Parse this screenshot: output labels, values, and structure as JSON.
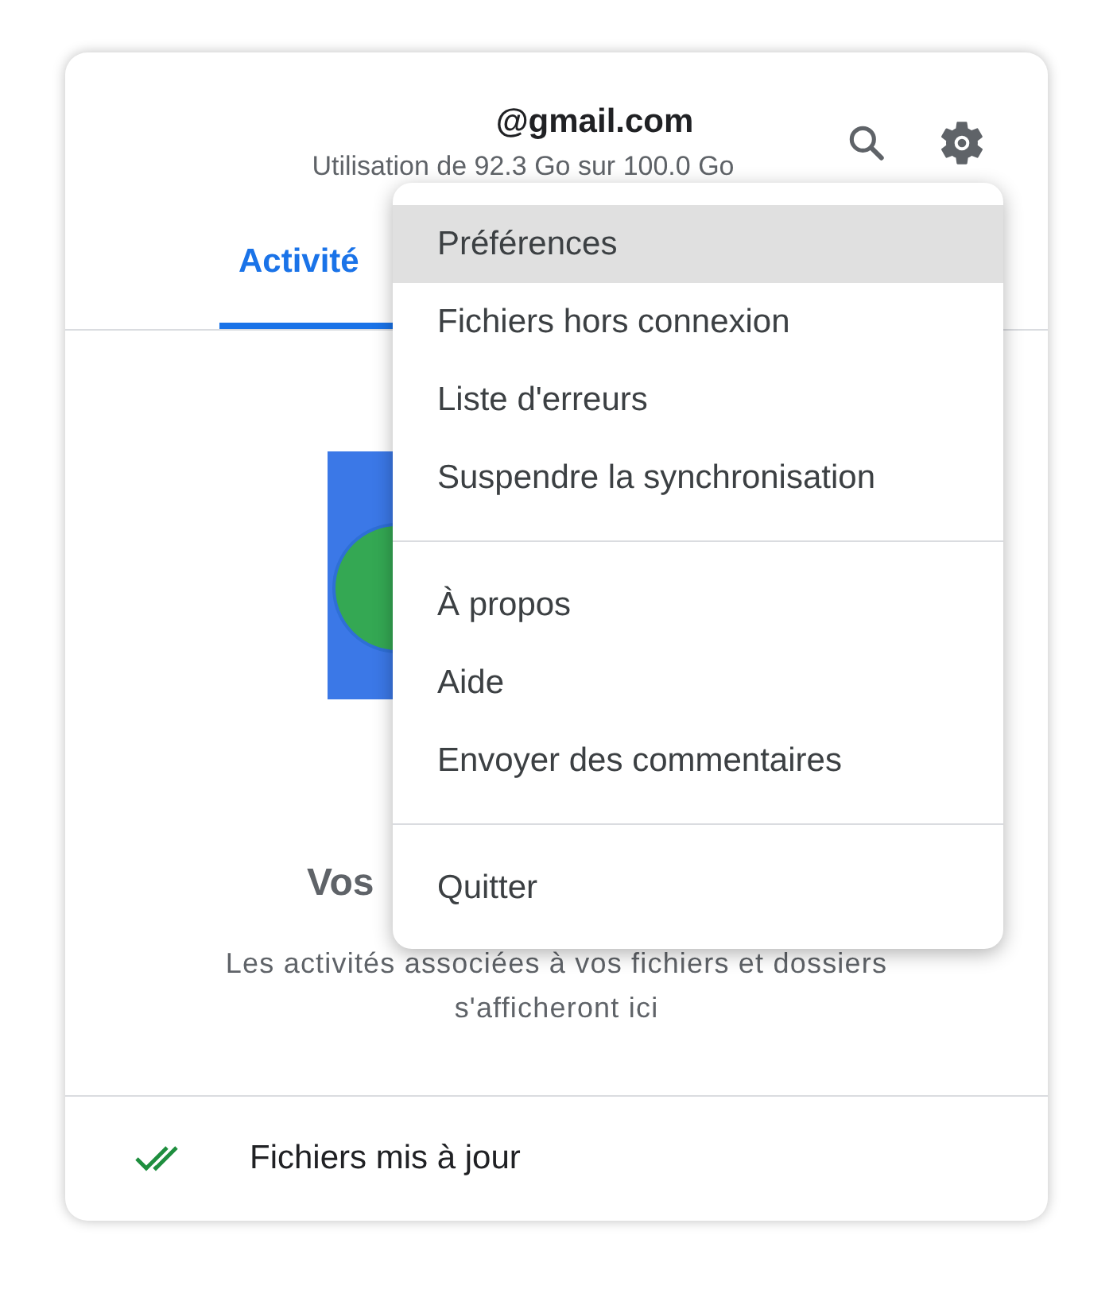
{
  "account": {
    "email": "@gmail.com",
    "usage": "Utilisation de 92.3 Go sur 100.0 Go"
  },
  "tabs": [
    {
      "label": "Activité",
      "selected": true
    }
  ],
  "empty_state": {
    "title": "Vos",
    "description": "Les activités associées à vos fichiers et dossiers s'afficheront ici"
  },
  "status_bar": {
    "text": "Fichiers mis à jour"
  },
  "menu": {
    "groups": [
      [
        {
          "label": "Préférences",
          "selected": true
        },
        {
          "label": "Fichiers hors connexion",
          "selected": false
        },
        {
          "label": "Liste d'erreurs",
          "selected": false
        },
        {
          "label": "Suspendre la synchronisation",
          "selected": false
        }
      ],
      [
        {
          "label": "À propos",
          "selected": false
        },
        {
          "label": "Aide",
          "selected": false
        },
        {
          "label": "Envoyer des commentaires",
          "selected": false
        }
      ],
      [
        {
          "label": "Quitter",
          "selected": false
        }
      ]
    ]
  }
}
